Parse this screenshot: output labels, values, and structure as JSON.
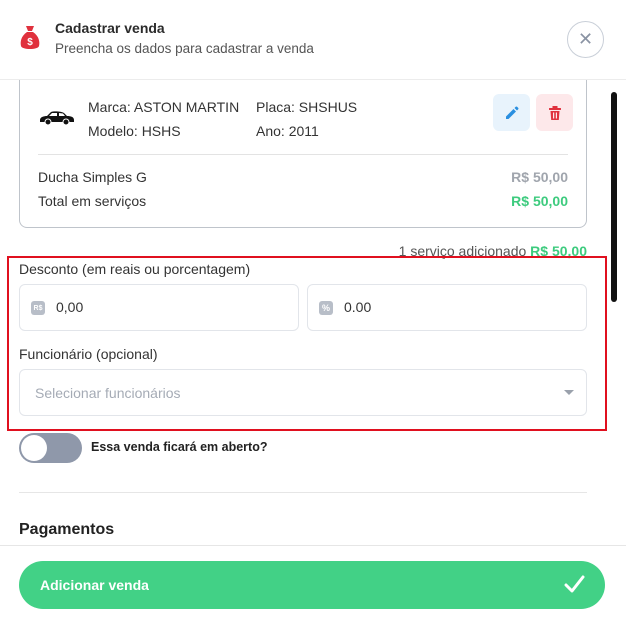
{
  "header": {
    "title": "Cadastrar venda",
    "subtitle": "Preencha os dados para cadastrar a venda",
    "close_symbol": "✕",
    "icon": "money-bag-icon"
  },
  "vehicle": {
    "brand": "Marca: ASTON MARTIN",
    "model": "Modelo: HSHS",
    "plate": "Placa: SHSHUS",
    "year": "Ano: 2011",
    "icon": "car-icon"
  },
  "services": [
    {
      "label": "Ducha Simples G",
      "price": "R$ 50,00",
      "color": "#a0a5ad"
    }
  ],
  "total": {
    "label": "Total em serviços",
    "value": "R$ 50,00",
    "color": "#3dcb7e"
  },
  "summary": {
    "text": "1 serviço adicionado",
    "value": "R$ 50,00"
  },
  "discount": {
    "label": "Desconto (em reais ou porcentagem)",
    "reais_badge": "R$",
    "reais_value": "0,00",
    "percent_badge": "%",
    "percent_value": "0.00"
  },
  "employee": {
    "label": "Funcionário (opcional)",
    "placeholder": "Selecionar funcionários"
  },
  "open_sale": {
    "label": "Essa venda ficará em aberto?",
    "checked": false
  },
  "payments": {
    "title": "Pagamentos"
  },
  "submit": {
    "label": "Adicionar venda",
    "icon": "check-icon"
  },
  "colors": {
    "accent_green": "#42d186",
    "highlight_red": "#e0101f",
    "edit_blue": "#2a8fe0",
    "delete_red": "#e0313d"
  }
}
